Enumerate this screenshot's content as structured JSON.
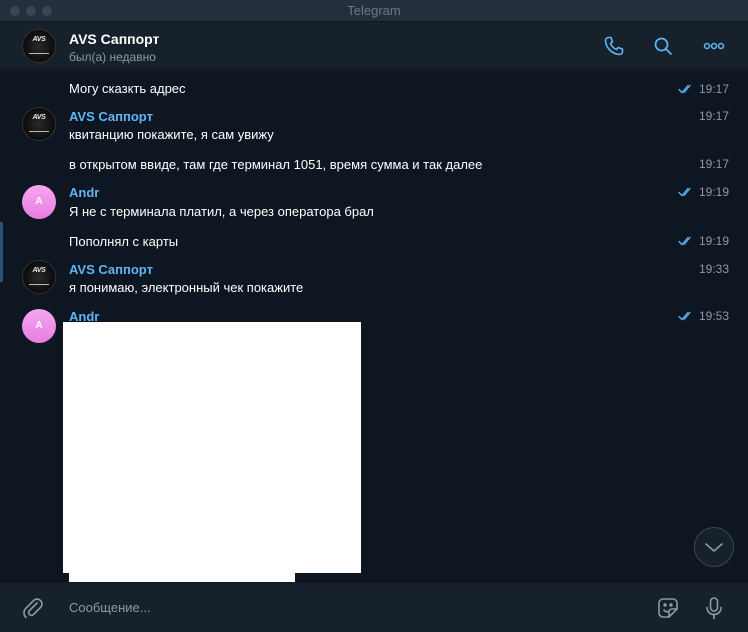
{
  "window": {
    "title": "Telegram"
  },
  "header": {
    "avatar_text": "AVS",
    "name": "AVS Саппорт",
    "status": "был(а) недавно",
    "icons": [
      "phone-icon",
      "search-icon",
      "more-icon"
    ]
  },
  "messages": [
    {
      "text": "Могу сказкть адрес",
      "time": "19:17",
      "read": true
    },
    {
      "author": "AVS Саппорт",
      "text": "квитанцию покажите, я сам увижу",
      "time": "19:17"
    },
    {
      "text": "в открытом ввиде, там где терминал 1051, время сумма и так далее",
      "time": "19:17"
    },
    {
      "author": "Andr",
      "avatar": "A",
      "text": "Я не с терминала платил, а через оператора брал",
      "time": "19:19",
      "read": true
    },
    {
      "text": "Пополнял с карты",
      "time": "19:19",
      "read": true
    },
    {
      "author": "AVS Саппорт",
      "text": "я понимаю, электронный чек покажите",
      "time": "19:33"
    },
    {
      "author": "Andr",
      "avatar": "A",
      "time": "19:53",
      "read": true,
      "attachment": "image"
    }
  ],
  "composer": {
    "placeholder": "Сообщение...",
    "icons": [
      "attach-icon",
      "sticker-icon",
      "microphone-icon"
    ]
  },
  "colors": {
    "background": "#0e1621",
    "panel": "#17212b",
    "accent": "#5eb5f7",
    "muted": "#8e99a4",
    "avatar_a": "#e77de1"
  }
}
